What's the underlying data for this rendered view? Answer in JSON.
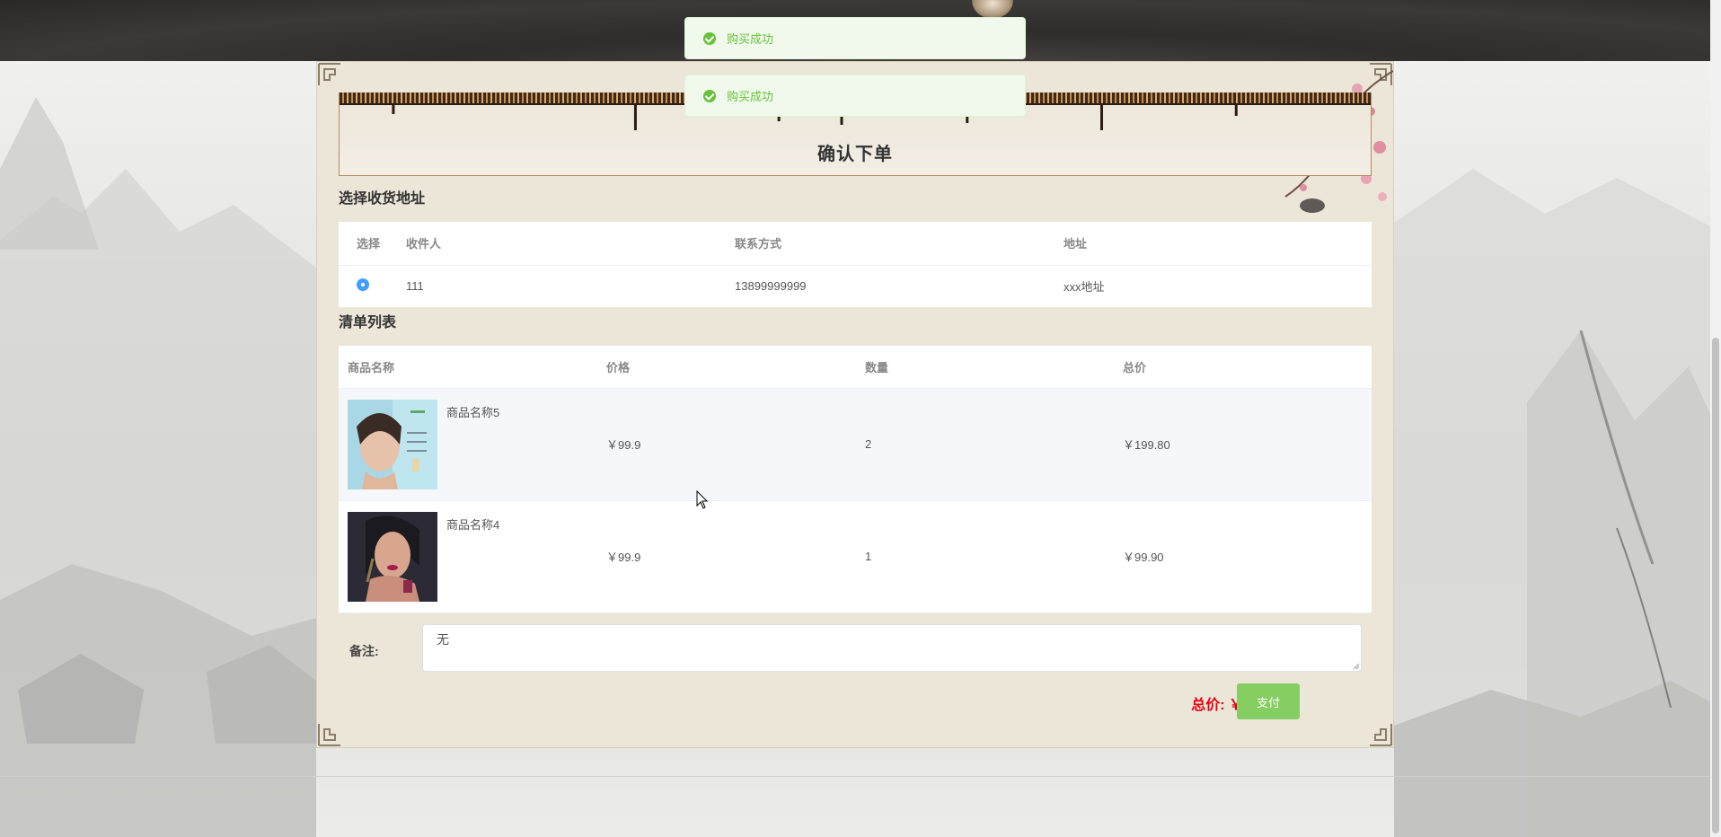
{
  "banner": {
    "title": "确认下单"
  },
  "address": {
    "section_title": "选择收货地址",
    "columns": [
      "选择",
      "收件人",
      "联系方式",
      "地址"
    ],
    "rows": [
      {
        "recipient": "111",
        "phone": "13899999999",
        "address": "xxx地址",
        "selected": true
      }
    ]
  },
  "items": {
    "section_title": "清单列表",
    "columns": [
      "商品名称",
      "价格",
      "数量",
      "总价"
    ],
    "rows": [
      {
        "name": "商品名称5",
        "price": "￥99.9",
        "qty": "2",
        "subtotal": "￥199.80"
      },
      {
        "name": "商品名称4",
        "price": "￥99.9",
        "qty": "1",
        "subtotal": "￥99.90"
      }
    ]
  },
  "remark": {
    "label": "备注:",
    "value": "无"
  },
  "summary": {
    "total": "总价: ￥299.70",
    "pay_label": "支付"
  },
  "toasts": [
    "购买成功",
    "购买成功"
  ],
  "colors": {
    "accent": "#409eff",
    "success": "#67c23a",
    "pay_button": "#85ce61",
    "total": "#e60012"
  }
}
